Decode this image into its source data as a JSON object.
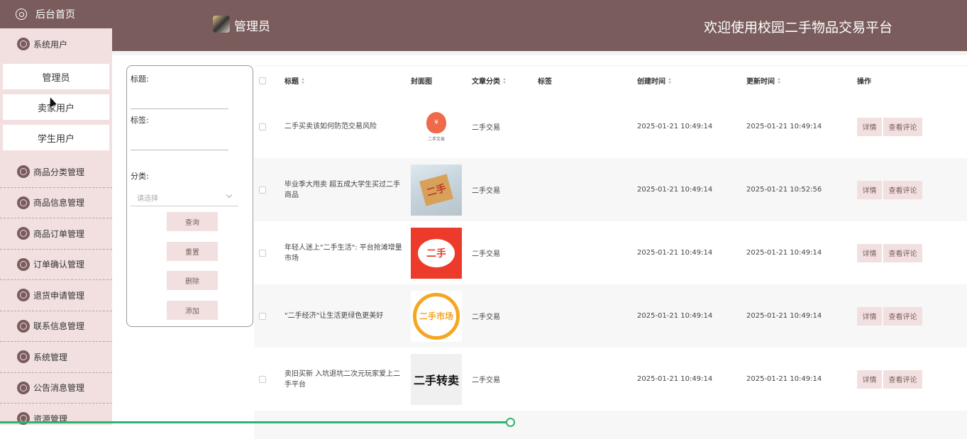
{
  "sidebar": {
    "home": "后台首页",
    "system_users": "系统用户",
    "sub_items": [
      "管理员",
      "卖家用户",
      "学生用户"
    ],
    "menus": [
      "商品分类管理",
      "商品信息管理",
      "商品订单管理",
      "订单确认管理",
      "退货申请管理",
      "联系信息管理",
      "系统管理",
      "公告消息管理",
      "资源管理"
    ]
  },
  "header": {
    "admin": "管理员",
    "welcome": "欢迎使用校园二手物品交易平台"
  },
  "filter": {
    "title_label": "标题:",
    "tag_label": "标签:",
    "category_label": "分类:",
    "category_placeholder": "请选择",
    "buttons": [
      "查询",
      "重置",
      "删除",
      "添加"
    ]
  },
  "table": {
    "headers": {
      "title": "标题",
      "cover": "封面图",
      "category": "文章分类",
      "tag": "标签",
      "created": "创建时间",
      "updated": "更新时间",
      "action": "操作"
    },
    "action_detail": "详情",
    "action_comments": "查看评论",
    "rows": [
      {
        "title": "二手买卖该如何防范交易风险",
        "cover": "money-bag",
        "cover_text": "二手交易",
        "category": "二手交易",
        "created": "2025-01-21 10:49:14",
        "updated": "2025-01-21 10:49:14"
      },
      {
        "title": "毕业季大甩卖 超五成大学生买过二手商品",
        "cover": "box-photo",
        "cover_text": "二手",
        "category": "二手交易",
        "created": "2025-01-21 10:49:14",
        "updated": "2025-01-21 10:52:56"
      },
      {
        "title": "年轻人迷上\"二手生活\": 平台抢滩增量市场",
        "cover": "red-speech",
        "cover_text": "二手",
        "category": "二手交易",
        "created": "2025-01-21 10:49:14",
        "updated": "2025-01-21 10:49:14"
      },
      {
        "title": "\"二手经济\"让生活更绿色更美好",
        "cover": "orange-bubble",
        "cover_text": "二手市场",
        "category": "二手交易",
        "created": "2025-01-21 10:49:14",
        "updated": "2025-01-21 10:49:14"
      },
      {
        "title": "卖旧买新 入坑退坑二次元玩家爱上二手平台",
        "cover": "calligraphy",
        "cover_text": "二手转卖",
        "category": "二手交易",
        "created": "2025-01-21 10:49:14",
        "updated": "2025-01-21 10:49:14"
      }
    ]
  },
  "colors": {
    "brand": "#7a5c5c",
    "sidebar_bg": "#f2e0e0",
    "scroll": "#2fb36d"
  }
}
